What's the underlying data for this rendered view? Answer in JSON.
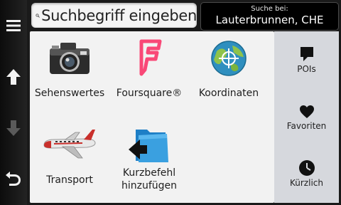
{
  "search": {
    "placeholder": "Suchbegriff eingeben"
  },
  "location": {
    "caption": "Suche bei:",
    "value": "Lauterbrunnen, CHE"
  },
  "categories": [
    {
      "label": "Sehenswertes",
      "icon": "camera-icon"
    },
    {
      "label": "Foursquare®",
      "icon": "foursquare-icon"
    },
    {
      "label": "Koordinaten",
      "icon": "globe-icon"
    },
    {
      "label": "Transport",
      "icon": "airplane-icon"
    },
    {
      "label": "Kurzbefehl hinzufügen",
      "icon": "folder-shortcut-icon"
    }
  ],
  "sidebar": [
    {
      "label": "POIs",
      "icon": "speech-flag-icon"
    },
    {
      "label": "Favoriten",
      "icon": "heart-icon"
    },
    {
      "label": "Kürzlich",
      "icon": "clock-icon"
    }
  ],
  "nav": [
    "menu-icon",
    "arrow-up-icon",
    "arrow-down-icon",
    "back-icon"
  ],
  "colors": {
    "foursquare": "#f94877",
    "panel": "#f2f2f2",
    "sidebar": "#d6d8dd"
  }
}
